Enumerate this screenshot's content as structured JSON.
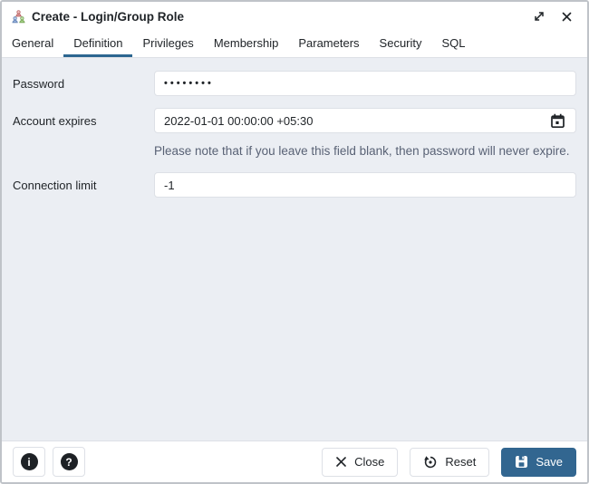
{
  "titlebar": {
    "title": "Create - Login/Group Role"
  },
  "tabs": [
    {
      "label": "General",
      "active": false
    },
    {
      "label": "Definition",
      "active": true
    },
    {
      "label": "Privileges",
      "active": false
    },
    {
      "label": "Membership",
      "active": false
    },
    {
      "label": "Parameters",
      "active": false
    },
    {
      "label": "Security",
      "active": false
    },
    {
      "label": "SQL",
      "active": false
    }
  ],
  "form": {
    "password": {
      "label": "Password",
      "value": "••••••••"
    },
    "account_expires": {
      "label": "Account expires",
      "value": "2022-01-01 00:00:00 +05:30",
      "icon": "calendar-icon"
    },
    "note": "Please note that if you leave this field blank, then password will never expire.",
    "connection_limit": {
      "label": "Connection limit",
      "value": "-1"
    }
  },
  "footer": {
    "info_glyph": "i",
    "help_glyph": "?",
    "close_label": "Close",
    "reset_label": "Reset",
    "save_label": "Save"
  },
  "icons": {
    "titlebar": [
      "login-group-role-icon",
      "maximize-icon",
      "close-icon"
    ],
    "buttons": [
      "info-icon",
      "help-icon",
      "close-x-icon",
      "reset-icon",
      "save-floppy-icon"
    ]
  },
  "colors": {
    "primary": "#326690",
    "tab_underline": "#2c6690",
    "body_bg": "#ebeef3",
    "input_border": "#dde0e6",
    "note_text": "#596275"
  }
}
